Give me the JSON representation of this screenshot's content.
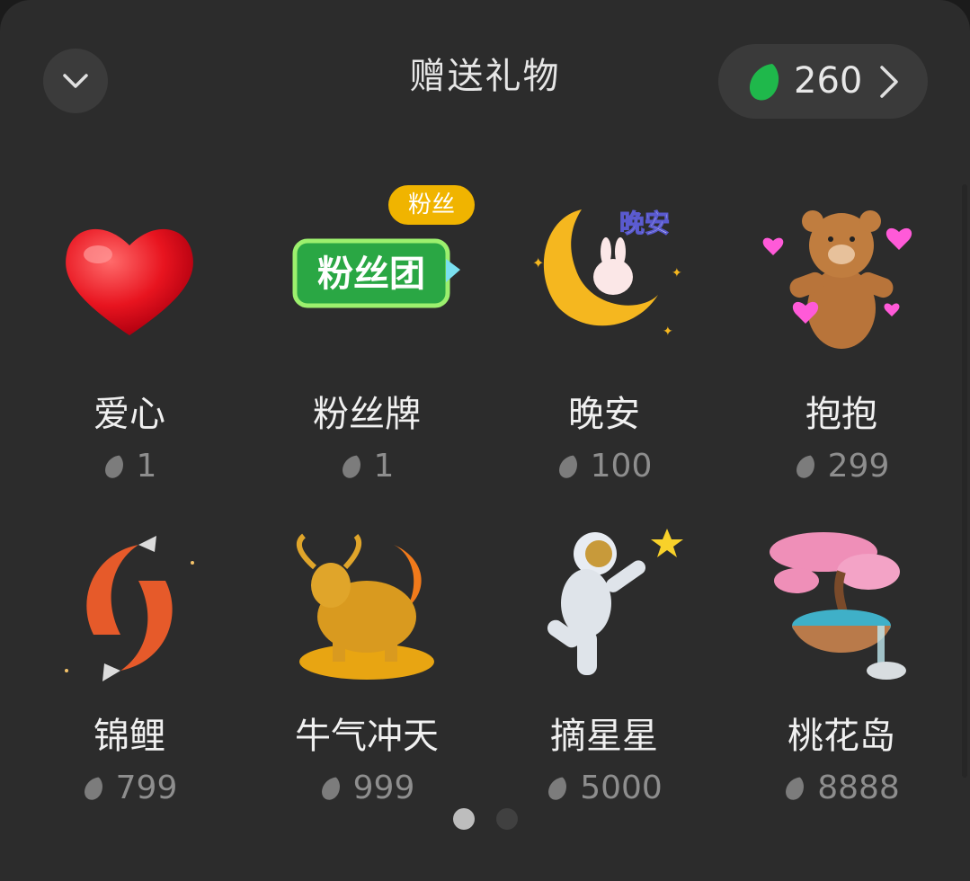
{
  "header": {
    "title": "赠送礼物",
    "balance": "260"
  },
  "badge": "粉丝",
  "art_texts": {
    "fanclub": "粉丝团",
    "goodnight": "晚安"
  },
  "gifts": [
    {
      "name": "爱心",
      "price": "1"
    },
    {
      "name": "粉丝牌",
      "price": "1"
    },
    {
      "name": "晚安",
      "price": "100"
    },
    {
      "name": "抱抱",
      "price": "299"
    },
    {
      "name": "锦鲤",
      "price": "799"
    },
    {
      "name": "牛气冲天",
      "price": "999"
    },
    {
      "name": "摘星星",
      "price": "5000"
    },
    {
      "name": "桃花岛",
      "price": "8888"
    }
  ],
  "pagination": {
    "count": 2,
    "active": 1
  },
  "colors": {
    "panel": "#2c2c2c",
    "leaf_green": "#1fb84b",
    "badge": "#f0b400",
    "price_gray": "#8e8e8e"
  },
  "icons": [
    "chevron-down-icon",
    "leaf-icon",
    "chevron-right-icon"
  ]
}
